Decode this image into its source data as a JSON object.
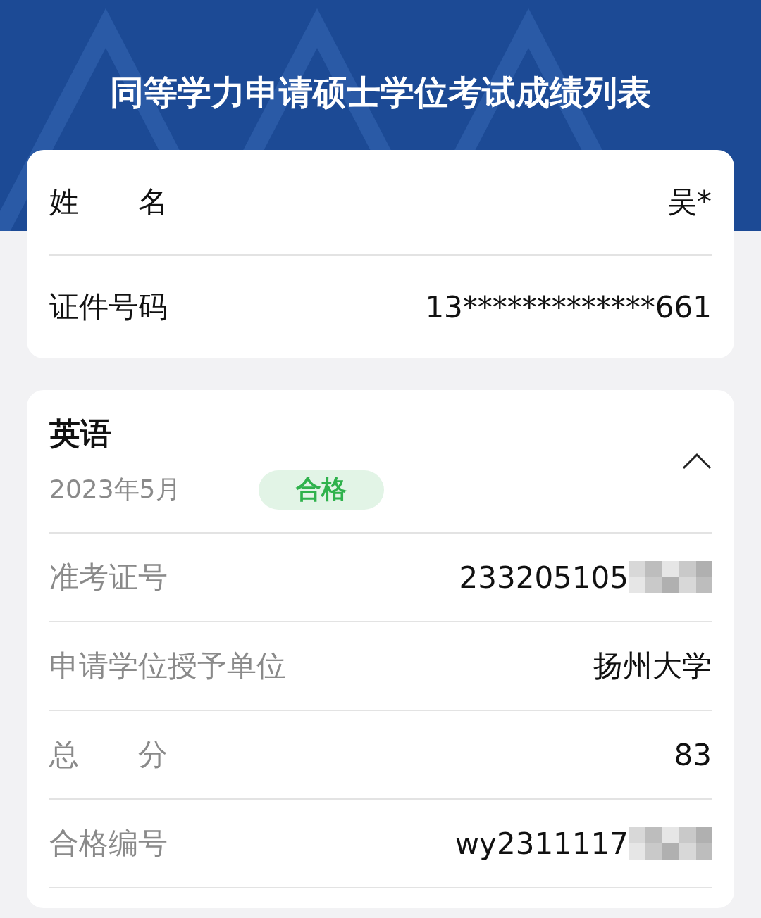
{
  "title": "同等学力申请硕士学位考试成绩列表",
  "identity": [
    {
      "label": "姓　　名",
      "value": "吴*"
    },
    {
      "label": "证件号码",
      "value": "13*************661"
    }
  ],
  "subject": {
    "name": "英语",
    "date": "2023年5月",
    "badge": "合格",
    "expanded": true,
    "rows": [
      {
        "label": "准考证号",
        "value": "233205105",
        "redacted": true
      },
      {
        "label": "申请学位授予单位",
        "value": "扬州大学",
        "redacted": false
      },
      {
        "label": "总　　分",
        "value": "83",
        "redacted": false
      },
      {
        "label": "合格编号",
        "value": "wy2311117",
        "redacted": true
      }
    ]
  }
}
